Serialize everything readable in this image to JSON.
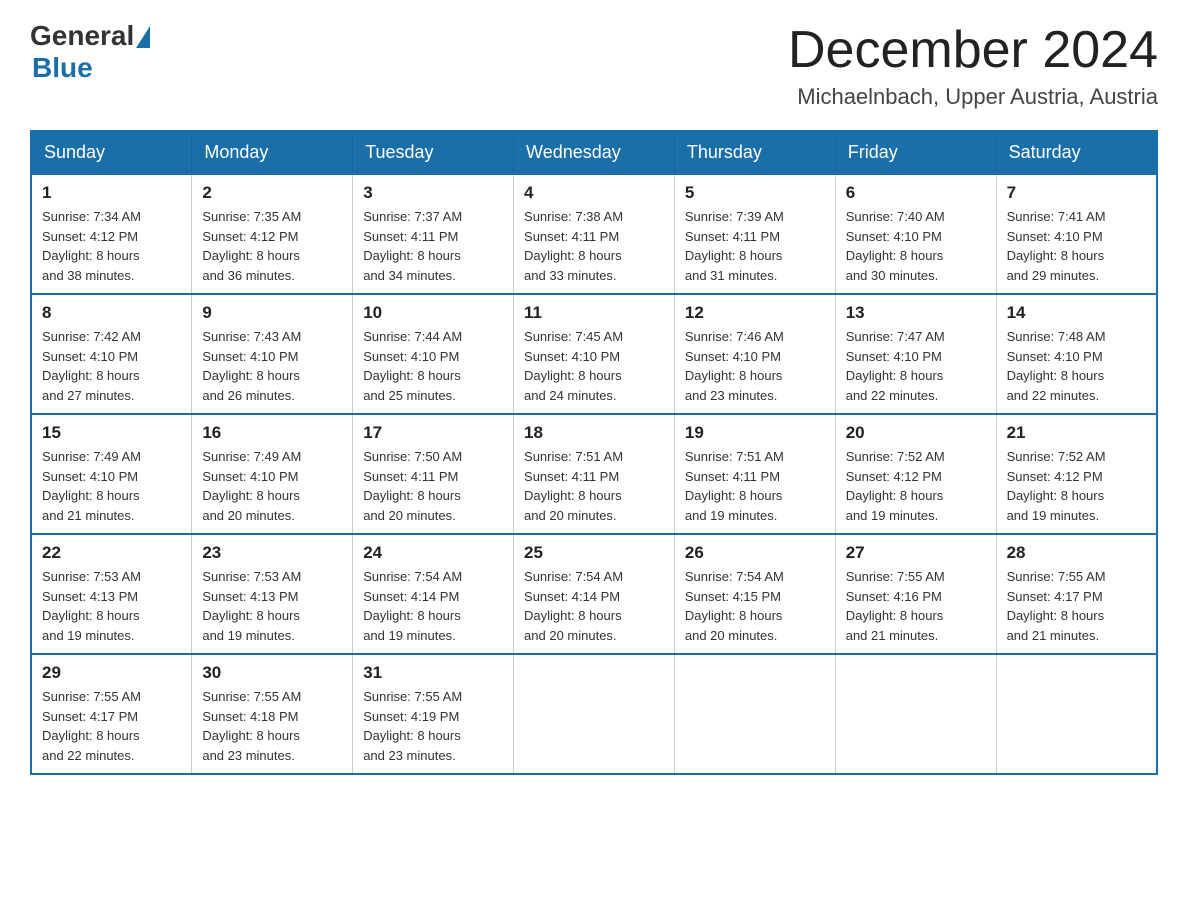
{
  "header": {
    "logo": {
      "general": "General",
      "blue": "Blue"
    },
    "title": "December 2024",
    "location": "Michaelnbach, Upper Austria, Austria"
  },
  "columns": [
    "Sunday",
    "Monday",
    "Tuesday",
    "Wednesday",
    "Thursday",
    "Friday",
    "Saturday"
  ],
  "weeks": [
    [
      {
        "day": "1",
        "sunrise": "7:34 AM",
        "sunset": "4:12 PM",
        "daylight": "8 hours and 38 minutes."
      },
      {
        "day": "2",
        "sunrise": "7:35 AM",
        "sunset": "4:12 PM",
        "daylight": "8 hours and 36 minutes."
      },
      {
        "day": "3",
        "sunrise": "7:37 AM",
        "sunset": "4:11 PM",
        "daylight": "8 hours and 34 minutes."
      },
      {
        "day": "4",
        "sunrise": "7:38 AM",
        "sunset": "4:11 PM",
        "daylight": "8 hours and 33 minutes."
      },
      {
        "day": "5",
        "sunrise": "7:39 AM",
        "sunset": "4:11 PM",
        "daylight": "8 hours and 31 minutes."
      },
      {
        "day": "6",
        "sunrise": "7:40 AM",
        "sunset": "4:10 PM",
        "daylight": "8 hours and 30 minutes."
      },
      {
        "day": "7",
        "sunrise": "7:41 AM",
        "sunset": "4:10 PM",
        "daylight": "8 hours and 29 minutes."
      }
    ],
    [
      {
        "day": "8",
        "sunrise": "7:42 AM",
        "sunset": "4:10 PM",
        "daylight": "8 hours and 27 minutes."
      },
      {
        "day": "9",
        "sunrise": "7:43 AM",
        "sunset": "4:10 PM",
        "daylight": "8 hours and 26 minutes."
      },
      {
        "day": "10",
        "sunrise": "7:44 AM",
        "sunset": "4:10 PM",
        "daylight": "8 hours and 25 minutes."
      },
      {
        "day": "11",
        "sunrise": "7:45 AM",
        "sunset": "4:10 PM",
        "daylight": "8 hours and 24 minutes."
      },
      {
        "day": "12",
        "sunrise": "7:46 AM",
        "sunset": "4:10 PM",
        "daylight": "8 hours and 23 minutes."
      },
      {
        "day": "13",
        "sunrise": "7:47 AM",
        "sunset": "4:10 PM",
        "daylight": "8 hours and 22 minutes."
      },
      {
        "day": "14",
        "sunrise": "7:48 AM",
        "sunset": "4:10 PM",
        "daylight": "8 hours and 22 minutes."
      }
    ],
    [
      {
        "day": "15",
        "sunrise": "7:49 AM",
        "sunset": "4:10 PM",
        "daylight": "8 hours and 21 minutes."
      },
      {
        "day": "16",
        "sunrise": "7:49 AM",
        "sunset": "4:10 PM",
        "daylight": "8 hours and 20 minutes."
      },
      {
        "day": "17",
        "sunrise": "7:50 AM",
        "sunset": "4:11 PM",
        "daylight": "8 hours and 20 minutes."
      },
      {
        "day": "18",
        "sunrise": "7:51 AM",
        "sunset": "4:11 PM",
        "daylight": "8 hours and 20 minutes."
      },
      {
        "day": "19",
        "sunrise": "7:51 AM",
        "sunset": "4:11 PM",
        "daylight": "8 hours and 19 minutes."
      },
      {
        "day": "20",
        "sunrise": "7:52 AM",
        "sunset": "4:12 PM",
        "daylight": "8 hours and 19 minutes."
      },
      {
        "day": "21",
        "sunrise": "7:52 AM",
        "sunset": "4:12 PM",
        "daylight": "8 hours and 19 minutes."
      }
    ],
    [
      {
        "day": "22",
        "sunrise": "7:53 AM",
        "sunset": "4:13 PM",
        "daylight": "8 hours and 19 minutes."
      },
      {
        "day": "23",
        "sunrise": "7:53 AM",
        "sunset": "4:13 PM",
        "daylight": "8 hours and 19 minutes."
      },
      {
        "day": "24",
        "sunrise": "7:54 AM",
        "sunset": "4:14 PM",
        "daylight": "8 hours and 19 minutes."
      },
      {
        "day": "25",
        "sunrise": "7:54 AM",
        "sunset": "4:14 PM",
        "daylight": "8 hours and 20 minutes."
      },
      {
        "day": "26",
        "sunrise": "7:54 AM",
        "sunset": "4:15 PM",
        "daylight": "8 hours and 20 minutes."
      },
      {
        "day": "27",
        "sunrise": "7:55 AM",
        "sunset": "4:16 PM",
        "daylight": "8 hours and 21 minutes."
      },
      {
        "day": "28",
        "sunrise": "7:55 AM",
        "sunset": "4:17 PM",
        "daylight": "8 hours and 21 minutes."
      }
    ],
    [
      {
        "day": "29",
        "sunrise": "7:55 AM",
        "sunset": "4:17 PM",
        "daylight": "8 hours and 22 minutes."
      },
      {
        "day": "30",
        "sunrise": "7:55 AM",
        "sunset": "4:18 PM",
        "daylight": "8 hours and 23 minutes."
      },
      {
        "day": "31",
        "sunrise": "7:55 AM",
        "sunset": "4:19 PM",
        "daylight": "8 hours and 23 minutes."
      },
      null,
      null,
      null,
      null
    ]
  ],
  "labels": {
    "sunrise": "Sunrise:",
    "sunset": "Sunset:",
    "daylight": "Daylight:"
  }
}
